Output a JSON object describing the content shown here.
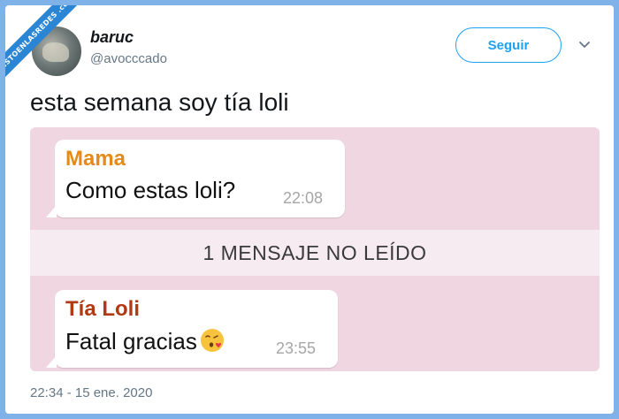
{
  "watermark": {
    "text": "VISTOENLASREDES .com"
  },
  "tweet": {
    "display_name": "baruc",
    "handle": "@avocccado",
    "follow_label": "Seguir",
    "text": "esta semana soy tía loli",
    "timestamp": "22:34 - 15 ene. 2020"
  },
  "chat": {
    "messages": [
      {
        "sender": "Mama",
        "sender_color": "#e58a16",
        "text": "Como estas loli?",
        "time": "22:08"
      },
      {
        "sender": "Tía Loli",
        "sender_color": "#b03a15",
        "text": "Fatal gracias",
        "emoji": "kissing-heart-icon",
        "time": "23:55"
      }
    ],
    "unread_banner": "1 MENSAJE NO LEÍDO"
  },
  "colors": {
    "accent": "#1da1f2",
    "chat_background": "#efd6e0",
    "outer_background": "#7fb2e8"
  }
}
